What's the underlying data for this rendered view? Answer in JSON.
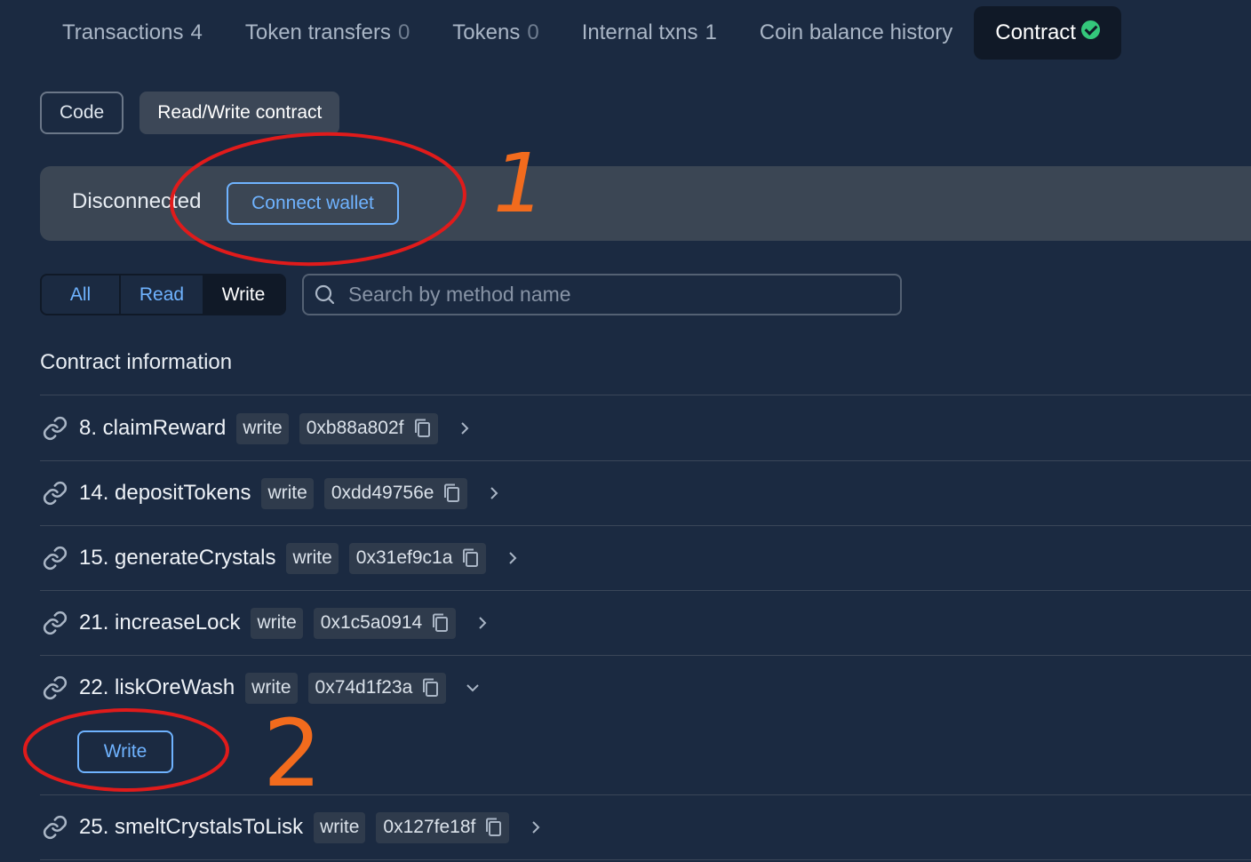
{
  "tabs": [
    {
      "label": "Transactions",
      "count": "4"
    },
    {
      "label": "Token transfers",
      "count": "0"
    },
    {
      "label": "Tokens",
      "count": "0"
    },
    {
      "label": "Internal txns",
      "count": "1"
    },
    {
      "label": "Coin balance history"
    },
    {
      "label": "Contract",
      "verified_icon": "check-circle-icon"
    }
  ],
  "subtabs": {
    "code": "Code",
    "read_write": "Read/Write contract"
  },
  "connection": {
    "status": "Disconnected",
    "button": "Connect wallet"
  },
  "filter": {
    "all": "All",
    "read": "Read",
    "write": "Write"
  },
  "search": {
    "placeholder": "Search by method name"
  },
  "section_title": "Contract information",
  "methods": [
    {
      "name": "8. claimReward",
      "badge": "write",
      "selector": "0xb88a802f"
    },
    {
      "name": "14. depositTokens",
      "badge": "write",
      "selector": "0xdd49756e"
    },
    {
      "name": "15. generateCrystals",
      "badge": "write",
      "selector": "0x31ef9c1a"
    },
    {
      "name": "21. increaseLock",
      "badge": "write",
      "selector": "0x1c5a0914"
    },
    {
      "name": "22. liskOreWash",
      "badge": "write",
      "selector": "0x74d1f23a",
      "expanded": true
    },
    {
      "name": "25. smeltCrystalsToLisk",
      "badge": "write",
      "selector": "0x127fe18f"
    }
  ],
  "expanded_action": {
    "write_button": "Write"
  },
  "annotations": {
    "one": "1",
    "two": "2",
    "circle_color": "#e01b1b",
    "number_color": "#f26b1d"
  },
  "colors": {
    "background": "#1b2a41",
    "accent": "#6fb3ff",
    "success": "#34c77b"
  }
}
